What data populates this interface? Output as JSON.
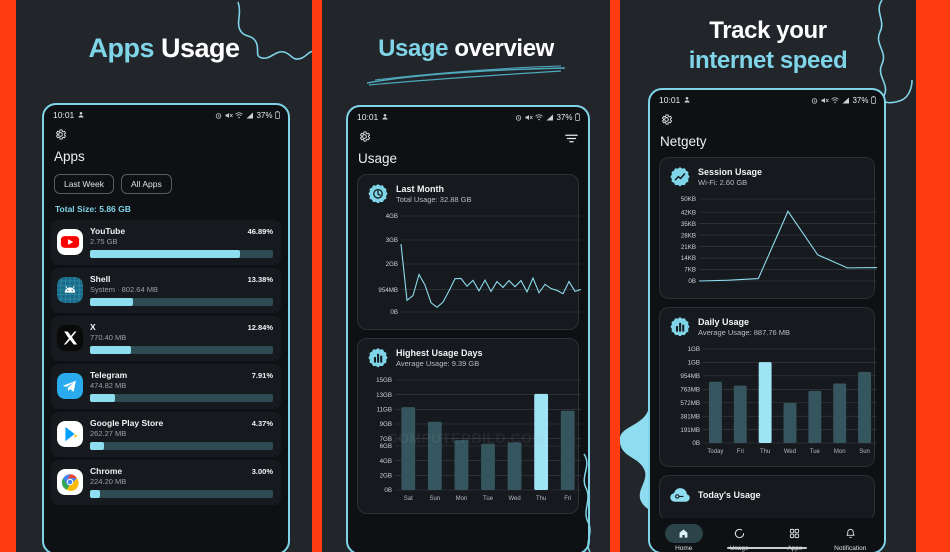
{
  "theme": {
    "accent_cyan": "#7fd4e8",
    "frame_red": "#ff3b10",
    "panel_bg": "#22252a",
    "phone_bg": "#0e1013",
    "card_bg": "#16191d",
    "bar_track": "#2e4a52",
    "bar_fill": "#8ddcef"
  },
  "watermark": "COMPUTERBILD.COM",
  "panel1": {
    "headline_part1": "Apps",
    "headline_part2": "Usage",
    "status": {
      "time": "10:01",
      "battery": "37%",
      "icons": [
        "person-icon",
        "alarm-icon",
        "mute-icon",
        "wifi-icon",
        "signal-icon",
        "battery-icon"
      ]
    },
    "topbar": {
      "settings_icon": "gear-icon"
    },
    "title": "Apps",
    "chips": [
      "Last Week",
      "All Apps"
    ],
    "total_size": "Total Size: 5.86 GB",
    "apps": [
      {
        "name": "YouTube",
        "sub": "2.75 GB",
        "pct": "46.89%",
        "pct_value": 46.89,
        "icon": "youtube-icon"
      },
      {
        "name": "Shell",
        "sub": "System · 802.64 MB",
        "pct": "13.38%",
        "pct_value": 13.38,
        "icon": "android-icon"
      },
      {
        "name": "X",
        "sub": "770.40 MB",
        "pct": "12.84%",
        "pct_value": 12.84,
        "icon": "x-icon"
      },
      {
        "name": "Telegram",
        "sub": "474.82 MB",
        "pct": "7.91%",
        "pct_value": 7.91,
        "icon": "telegram-icon"
      },
      {
        "name": "Google Play Store",
        "sub": "262.27 MB",
        "pct": "4.37%",
        "pct_value": 4.37,
        "icon": "play-store-icon"
      },
      {
        "name": "Chrome",
        "sub": "224.20 MB",
        "pct": "3.00%",
        "pct_value": 3.0,
        "icon": "chrome-icon"
      }
    ]
  },
  "panel2": {
    "headline_part1": "Usage",
    "headline_part2": "overview",
    "status": {
      "time": "10:01",
      "battery": "37%"
    },
    "topbar": {
      "settings_icon": "gear-icon",
      "filter_icon": "filter-icon"
    },
    "title": "Usage",
    "cards": [
      {
        "title": "Last Month",
        "subtitle": "Total Usage: 32.88 GB",
        "icon": "clock-badge-icon"
      },
      {
        "title": "Highest Usage Days",
        "subtitle": "Average Usage: 9.39 GB",
        "icon": "bars-badge-icon"
      }
    ]
  },
  "panel3": {
    "headline_part1": "Track your",
    "headline_part2": "internet speed",
    "status": {
      "time": "10:01",
      "battery": "37%"
    },
    "topbar": {
      "settings_icon": "gear-icon"
    },
    "title": "Netgety",
    "cards": [
      {
        "title": "Session Usage",
        "subtitle": "Wi-Fi: 2.60 GB",
        "icon": "trend-badge-icon"
      },
      {
        "title": "Daily Usage",
        "subtitle": "Average Usage: 887.76 MB",
        "icon": "bars-badge-icon"
      },
      {
        "title": "Today's Usage",
        "subtitle": "",
        "icon": "cloud-badge-icon"
      }
    ],
    "nav": [
      {
        "label": "Home",
        "icon": "home-icon",
        "active": true
      },
      {
        "label": "Usage",
        "icon": "circle-icon",
        "active": false
      },
      {
        "label": "Apps",
        "icon": "grid-icon",
        "active": false
      },
      {
        "label": "Notification",
        "icon": "bell-icon",
        "active": false
      }
    ]
  },
  "chart_data": [
    {
      "id": "last-month-line",
      "type": "line",
      "title": "Last Month",
      "subtitle": "Total Usage: 32.88 GB",
      "ylabel": "",
      "xlabel": "",
      "ytick_labels": [
        "4GB",
        "3GB",
        "2GB",
        "954MB",
        "0B"
      ],
      "ytick_values": [
        4096,
        3072,
        2048,
        954,
        0
      ],
      "ylim": [
        0,
        4096
      ],
      "grid": true,
      "legend": "none",
      "unit": "MB",
      "values": [
        2900,
        500,
        700,
        1600,
        1150,
        400,
        200,
        420,
        900,
        1420,
        1430,
        1100,
        1350,
        900,
        1360,
        880,
        1300,
        1050,
        1340,
        1080,
        1340,
        860,
        1450,
        820,
        1180,
        1000,
        920,
        780,
        1300,
        880,
        960
      ]
    },
    {
      "id": "highest-usage-days-bar",
      "type": "bar",
      "title": "Highest Usage Days",
      "subtitle": "Average Usage: 9.39 GB",
      "categories": [
        "Sat",
        "Sun",
        "Mon",
        "Tue",
        "Wed",
        "Thu",
        "Fri"
      ],
      "values": [
        11.3,
        9.3,
        6.8,
        6.3,
        6.5,
        13.1,
        10.8
      ],
      "highlight_index": 5,
      "ytick_labels": [
        "15GB",
        "13GB",
        "11GB",
        "9GB",
        "7GB",
        "6GB",
        "4GB",
        "2GB",
        "0B"
      ],
      "ytick_values": [
        15,
        13,
        11,
        9,
        7,
        6,
        4,
        2,
        0
      ],
      "ylim": [
        0,
        15
      ],
      "unit": "GB",
      "grid": true,
      "legend": "none",
      "xlabel": "",
      "ylabel": ""
    },
    {
      "id": "session-usage-line",
      "type": "line",
      "title": "Session Usage",
      "subtitle": "Wi-Fi: 2.60 GB",
      "ytick_labels": [
        "50KB",
        "42KB",
        "35KB",
        "28KB",
        "21KB",
        "14KB",
        "7KB",
        "0B"
      ],
      "ytick_values": [
        50,
        42,
        35,
        28,
        21,
        14,
        7,
        0
      ],
      "ylim": [
        0,
        50
      ],
      "unit": "KB",
      "grid": true,
      "legend": "none",
      "xlabel": "",
      "ylabel": "",
      "values": [
        0,
        0.5,
        1.5,
        42.5,
        16,
        8,
        8.2
      ]
    },
    {
      "id": "daily-usage-bar",
      "type": "bar",
      "title": "Daily Usage",
      "subtitle": "Average Usage: 887.76 MB",
      "categories": [
        "Today",
        "Fri",
        "Thu",
        "Wed",
        "Tue",
        "Mon",
        "Sun"
      ],
      "values": [
        870,
        815,
        1150,
        570,
        740,
        845,
        1010
      ],
      "highlight_index": 2,
      "ytick_labels": [
        "1GB",
        "1GB",
        "954MB",
        "763MB",
        "572MB",
        "381MB",
        "191MB",
        "0B"
      ],
      "ytick_values": [
        1336,
        1145,
        954,
        763,
        572,
        381,
        191,
        0
      ],
      "ylim": [
        0,
        1336
      ],
      "unit": "MB",
      "grid": true,
      "legend": "none",
      "xlabel": "",
      "ylabel": ""
    }
  ]
}
